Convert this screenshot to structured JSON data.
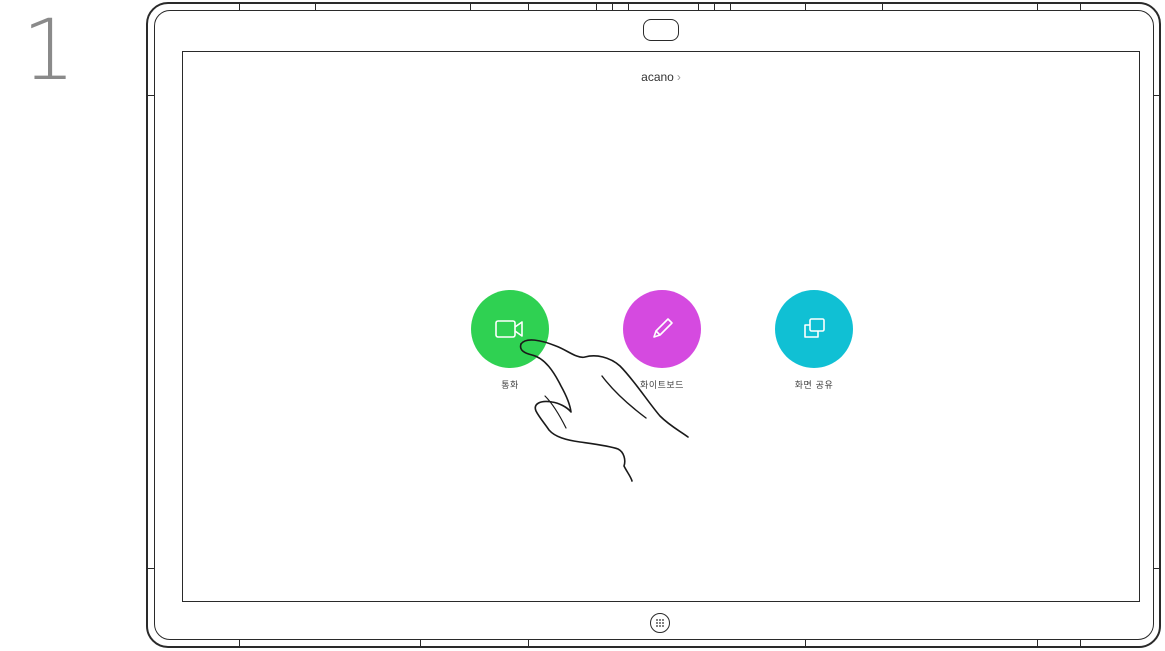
{
  "step": "1",
  "header": {
    "title": "acano",
    "chevron": "›"
  },
  "actions": [
    {
      "label": "통화",
      "color": "#2fd152",
      "icon": "video-camera-icon"
    },
    {
      "label": "화이트보드",
      "color": "#d54ae0",
      "icon": "pencil-icon"
    },
    {
      "label": "화면 공유",
      "color": "#10c0d4",
      "icon": "share-screen-icon"
    }
  ],
  "colors": {
    "outline": "#2a2a2a",
    "step_number": "#8a8a8a"
  }
}
